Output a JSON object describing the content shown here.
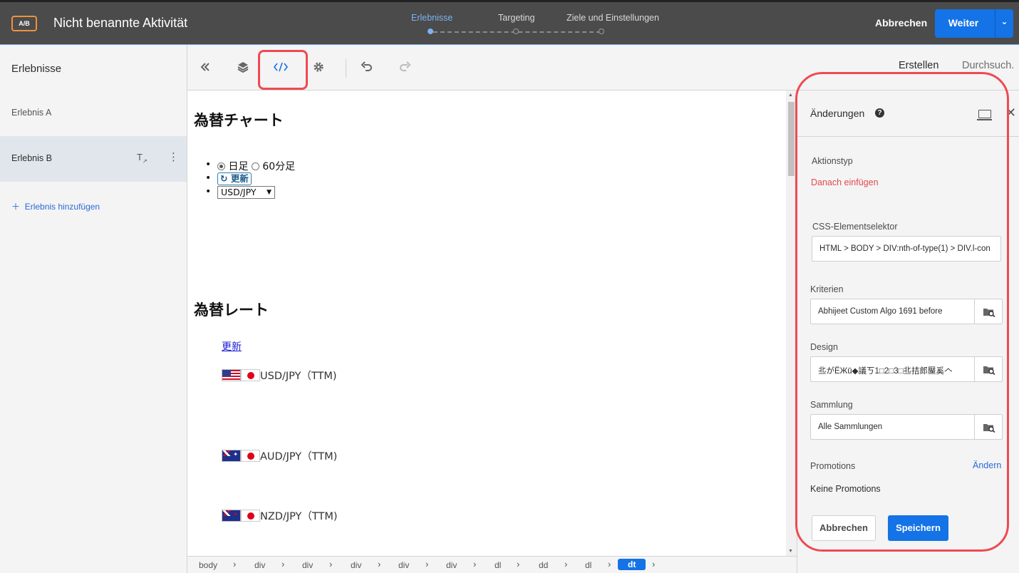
{
  "topbar": {
    "badge": "A/B",
    "activity_title": "Nicht benannte Aktivität",
    "steps": [
      "Erlebnisse",
      "Targeting",
      "Ziele und Einstellungen"
    ],
    "active_step": 0,
    "cancel_label": "Abbrechen",
    "next_label": "Weiter",
    "accent_color": "#1473e6"
  },
  "sidebar": {
    "title": "Erlebnisse",
    "items": [
      {
        "label": "Erlebnis A",
        "selected": false
      },
      {
        "label": "Erlebnis B",
        "selected": true
      }
    ],
    "add_label": "Erlebnis hinzufügen"
  },
  "toolbar": {
    "icons": [
      "collapse-icon",
      "layers-icon",
      "code-icon",
      "gear-icon",
      "undo-icon",
      "redo-icon"
    ],
    "tab_create": "Erstellen",
    "tab_browse": "Durchsuch."
  },
  "preview": {
    "chart_heading": "為替チャート",
    "radio_daily": "日足",
    "radio_60min": "60分足",
    "update_button": "更新",
    "pair_select": "USD/JPY",
    "rate_heading": "為替レート",
    "update_link": "更新",
    "rates": [
      {
        "flag": "us",
        "label": "USD/JPY（TTM)"
      },
      {
        "flag": "au",
        "label": "AUD/JPY（TTM)"
      },
      {
        "flag": "nz",
        "label": "NZD/JPY（TTM)"
      }
    ]
  },
  "breadcrumbs": [
    "body",
    "div",
    "div",
    "div",
    "div",
    "div",
    "dl",
    "dd",
    "dl",
    "dt"
  ],
  "panel": {
    "title": "Änderungen",
    "action_type_label": "Aktionstyp",
    "action_type_value": "Danach einfügen",
    "css_selector_label": "CSS-Elementselektor",
    "css_selector_value": "HTML > BODY > DIV:nth-of-type(1) > DIV.l-con",
    "criteria_label": "Kriterien",
    "criteria_value": "Abhijeet Custom Algo 1691 before",
    "design_label": "Design",
    "design_value": "丠がËЖū◆議ㄎ1□2□3□丠拮郎黶奚𠆢",
    "collection_label": "Sammlung",
    "collection_value": "Alle Sammlungen",
    "promotions_label": "Promotions",
    "promotions_change": "Ändern",
    "promotions_value": "Keine Promotions",
    "cancel_label": "Abbrechen",
    "save_label": "Speichern",
    "error_color": "#e34850"
  }
}
